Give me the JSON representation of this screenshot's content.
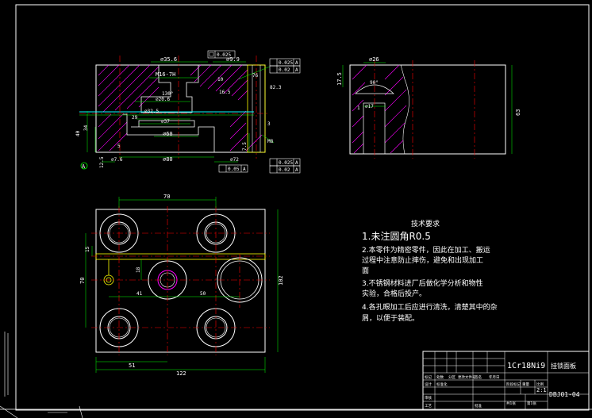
{
  "drawing": {
    "colors": {
      "background": "#000000",
      "outline": "#ffffff",
      "centerline": "#ff0000",
      "hatch": "#ff00ff",
      "dimension": "#00ff00",
      "cyan_geometry": "#00ffff",
      "yellow_geometry": "#ffff00",
      "border": "#ffffff"
    },
    "section_view": {
      "dims": {
        "d1": "⌀35.6",
        "d2": "⌀9.9",
        "d3": "M16-7H",
        "d4": "⌀20.6",
        "d5": "⌀32.5",
        "d6": "⌀37",
        "d7": "⌀80",
        "d8": "⌀60",
        "d9": "⌀72",
        "d10": "130°",
        "d11": "40",
        "d12": "34",
        "d13": "10",
        "d14": "⌀7.6",
        "d15": "12.5",
        "d16": "3",
        "d17": "5",
        "d18": "7.5",
        "d19": "16.5",
        "d20": "82.3",
        "d21": "76",
        "d22": "29",
        "d23": "M8",
        "datum": "A"
      },
      "tolerances": {
        "flat_top": "0.025",
        "pos_top_1": "0.025",
        "pos_top_1_ref": "A",
        "pos_top_2": "0.02",
        "pos_top_2_ref": "A",
        "pos_bot_1": "0.025",
        "pos_bot_1_ref": "A",
        "pos_bot_2": "0.02",
        "pos_bot_2_ref": "A",
        "bottom_left": "0.05",
        "bottom_left_ref": "A"
      }
    },
    "side_view": {
      "dims": {
        "top": "⌀26",
        "left": "17.5",
        "angle": "90°",
        "hole": "⌀17",
        "height": "63",
        "mark": "1"
      }
    },
    "plan_view": {
      "dims": {
        "top": "70",
        "left_small": "15",
        "left_big": "70",
        "inner": "18",
        "inner2": "41",
        "inner3": "50",
        "right": "102",
        "bottom1": "51",
        "bottom2": "122"
      }
    },
    "notes": {
      "title": "技术要求",
      "lines": [
        "1.未注圆角R0.5",
        "2.本零件为精密零件，因此在加工、搬运",
        "过程中注意防止摔伤，避免和出现加工",
        "面",
        "3.不锈钢材料进厂后做化学分析和物性",
        "实验，合格后投产。",
        "4.各孔眼加工后应进行清洗，清楚其中的杂",
        "屑，以便于装配。"
      ]
    },
    "title_block": {
      "material": "1Cr18Ni9",
      "part_name": "挂锁面板",
      "drawing_no": "DBJ01-04",
      "cells": [
        "标记",
        "处数",
        "分区",
        "更改文件号",
        "签名",
        "年月日",
        "设计",
        "标准化",
        "阶段标记",
        "重量",
        "比例",
        "审核",
        "工艺",
        "批准",
        "共1张",
        "第1张"
      ],
      "scale": "2:1"
    }
  }
}
